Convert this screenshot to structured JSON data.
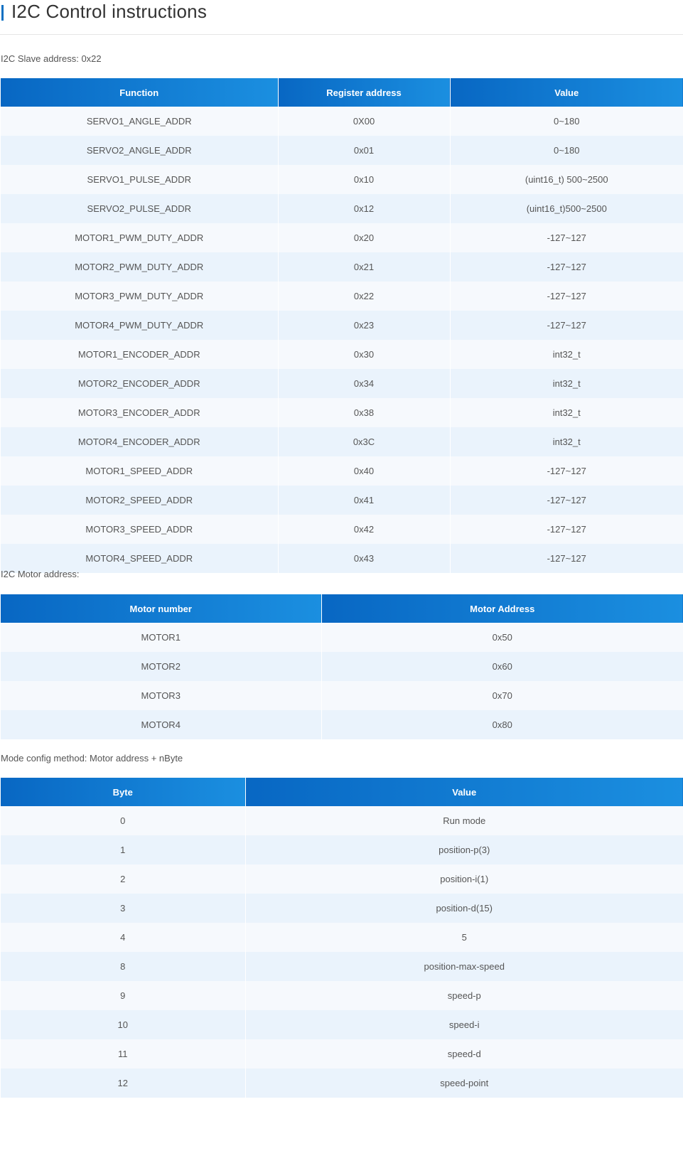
{
  "page_title": "I2C Control instructions",
  "slave_section": {
    "label": "I2C Slave address: 0x22",
    "headers": [
      "Function",
      "Register address",
      "Value"
    ],
    "rows": [
      [
        "SERVO1_ANGLE_ADDR",
        "0X00",
        "0~180"
      ],
      [
        "SERVO2_ANGLE_ADDR",
        "0x01",
        "0~180"
      ],
      [
        "SERVO1_PULSE_ADDR",
        "0x10",
        "(uint16_t) 500~2500"
      ],
      [
        "SERVO2_PULSE_ADDR",
        "0x12",
        "(uint16_t)500~2500"
      ],
      [
        "MOTOR1_PWM_DUTY_ADDR",
        "0x20",
        "-127~127"
      ],
      [
        "MOTOR2_PWM_DUTY_ADDR",
        "0x21",
        "-127~127"
      ],
      [
        "MOTOR3_PWM_DUTY_ADDR",
        "0x22",
        "-127~127"
      ],
      [
        "MOTOR4_PWM_DUTY_ADDR",
        "0x23",
        "-127~127"
      ],
      [
        "MOTOR1_ENCODER_ADDR",
        "0x30",
        "int32_t"
      ],
      [
        "MOTOR2_ENCODER_ADDR",
        "0x34",
        "int32_t"
      ],
      [
        "MOTOR3_ENCODER_ADDR",
        "0x38",
        "int32_t"
      ],
      [
        "MOTOR4_ENCODER_ADDR",
        "0x3C",
        "int32_t"
      ],
      [
        "MOTOR1_SPEED_ADDR",
        "0x40",
        "-127~127"
      ],
      [
        "MOTOR2_SPEED_ADDR",
        "0x41",
        "-127~127"
      ],
      [
        "MOTOR3_SPEED_ADDR",
        "0x42",
        "-127~127"
      ],
      [
        "MOTOR4_SPEED_ADDR",
        "0x43",
        "-127~127"
      ]
    ]
  },
  "motor_section": {
    "label": "I2C Motor address:",
    "headers": [
      "Motor number",
      "Motor Address"
    ],
    "rows": [
      [
        "MOTOR1",
        "0x50"
      ],
      [
        "MOTOR2",
        "0x60"
      ],
      [
        "MOTOR3",
        "0x70"
      ],
      [
        "MOTOR4",
        "0x80"
      ]
    ]
  },
  "mode_section": {
    "label": "Mode config method: Motor address + nByte",
    "headers": [
      "Byte",
      "Value"
    ],
    "rows": [
      [
        "0",
        "Run mode"
      ],
      [
        "1",
        "position-p(3)"
      ],
      [
        "2",
        "position-i(1)"
      ],
      [
        "3",
        "position-d(15)"
      ],
      [
        "4",
        "5"
      ],
      [
        "8",
        "position-max-speed"
      ],
      [
        "9",
        "speed-p"
      ],
      [
        "10",
        "speed-i"
      ],
      [
        "11",
        "speed-d"
      ],
      [
        "12",
        "speed-point"
      ]
    ]
  },
  "colors": {
    "accent": "#0a6fc2",
    "header_start": "#0867c3",
    "header_end": "#1b8fe0",
    "row_light": "#f6f9fd",
    "row_tint": "#eaf3fc"
  }
}
